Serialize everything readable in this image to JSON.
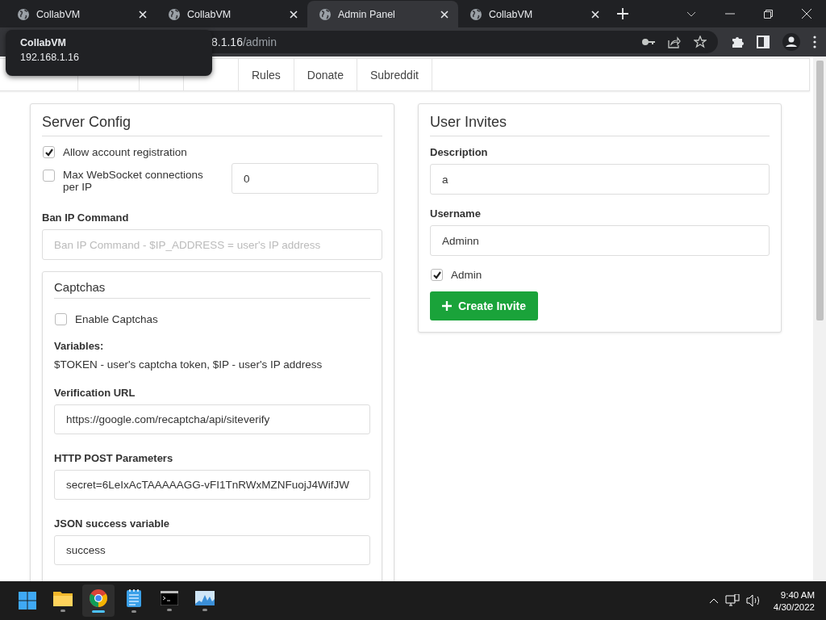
{
  "browser": {
    "tabs": [
      {
        "title": "CollabVM",
        "selected": false
      },
      {
        "title": "CollabVM",
        "selected": false
      },
      {
        "title": "Admin Panel",
        "selected": true
      },
      {
        "title": "CollabVM",
        "selected": false
      }
    ],
    "tooltip": {
      "title": "CollabVM",
      "url": "192.168.1.16"
    },
    "address": {
      "host": "8.1.16",
      "path": "/admin"
    }
  },
  "nav": {
    "items": [
      {
        "kind": "covered"
      },
      {
        "kind": "covered"
      },
      {
        "kind": "covered"
      },
      {
        "kind": "covered"
      },
      {
        "kind": "link",
        "label": "Rules"
      },
      {
        "kind": "link",
        "label": "Donate"
      },
      {
        "kind": "link",
        "label": "Subreddit"
      }
    ]
  },
  "server_config": {
    "title": "Server Config",
    "allow_registration": {
      "label": "Allow account registration",
      "checked": true
    },
    "max_ws": {
      "label": "Max WebSocket connections per IP",
      "checked": false,
      "value": "0"
    },
    "ban_ip": {
      "label": "Ban IP Command",
      "placeholder": "Ban IP Command - $IP_ADDRESS = user's IP address"
    },
    "captchas": {
      "title": "Captchas",
      "enable": {
        "label": "Enable Captchas",
        "checked": false
      },
      "variables_label": "Variables:",
      "variables_text": "$TOKEN - user's captcha token, $IP - user's IP address",
      "fields": [
        {
          "label": "Verification URL",
          "value": "https://google.com/recaptcha/api/siteverify"
        },
        {
          "label": "HTTP POST Parameters",
          "value": "secret=6LeIxAcTAAAAAGG-vFI1TnRWxMZNFuojJ4WifJW"
        },
        {
          "label": "JSON success variable",
          "value": "success"
        }
      ]
    }
  },
  "user_invites": {
    "title": "User Invites",
    "description": {
      "label": "Description",
      "value": "a"
    },
    "username": {
      "label": "Username",
      "value": "Adminn"
    },
    "admin": {
      "label": "Admin",
      "checked": true
    },
    "button": "Create Invite"
  },
  "taskbar": {
    "apps": [
      {
        "kind": "start",
        "selected": false
      },
      {
        "kind": "explorer",
        "selected": false
      },
      {
        "kind": "chrome",
        "selected": true
      },
      {
        "kind": "notepad",
        "selected": false
      },
      {
        "kind": "terminal",
        "selected": false
      },
      {
        "kind": "monitor",
        "selected": false
      }
    ],
    "time": "9:40 AM",
    "date": "4/30/2022"
  }
}
